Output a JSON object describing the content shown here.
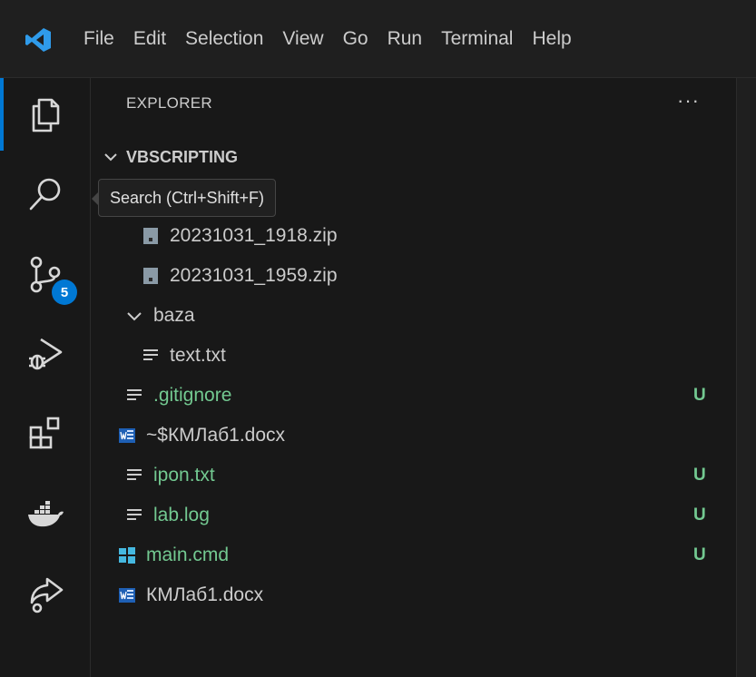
{
  "menu": [
    "File",
    "Edit",
    "Selection",
    "View",
    "Go",
    "Run",
    "Terminal",
    "Help"
  ],
  "activity_bar": {
    "items": [
      {
        "name": "explorer-icon",
        "active": true
      },
      {
        "name": "search-icon"
      },
      {
        "name": "source-control-icon",
        "badge": "5"
      },
      {
        "name": "run-debug-icon"
      },
      {
        "name": "extensions-icon"
      },
      {
        "name": "docker-icon"
      },
      {
        "name": "remote-explorer-icon"
      }
    ]
  },
  "sidebar": {
    "title": "EXPLORER",
    "more_actions": "···",
    "folder": "VBSCRIPTING"
  },
  "tooltip": "Search (Ctrl+Shift+F)",
  "tree": [
    {
      "label": "20231031_1918.zip",
      "icon": "zip-icon",
      "status": ""
    },
    {
      "label": "20231031_1959.zip",
      "icon": "zip-icon",
      "status": ""
    },
    {
      "label": "baza",
      "icon": "chevron-down-icon",
      "status": ""
    },
    {
      "label": "text.txt",
      "icon": "text-file-icon",
      "status": ""
    },
    {
      "label": ".gitignore",
      "icon": "text-file-icon",
      "status": "U"
    },
    {
      "label": "~$КМЛаб1.docx",
      "icon": "word-icon",
      "status": ""
    },
    {
      "label": "ipon.txt",
      "icon": "text-file-icon",
      "status": "U"
    },
    {
      "label": "lab.log",
      "icon": "text-file-icon",
      "status": "U"
    },
    {
      "label": "main.cmd",
      "icon": "windows-icon",
      "status": "U"
    },
    {
      "label": "КМЛаб1.docx",
      "icon": "word-icon",
      "status": ""
    }
  ],
  "colors": {
    "accent": "#0078d4",
    "untracked": "#73c991",
    "background": "#181818"
  }
}
